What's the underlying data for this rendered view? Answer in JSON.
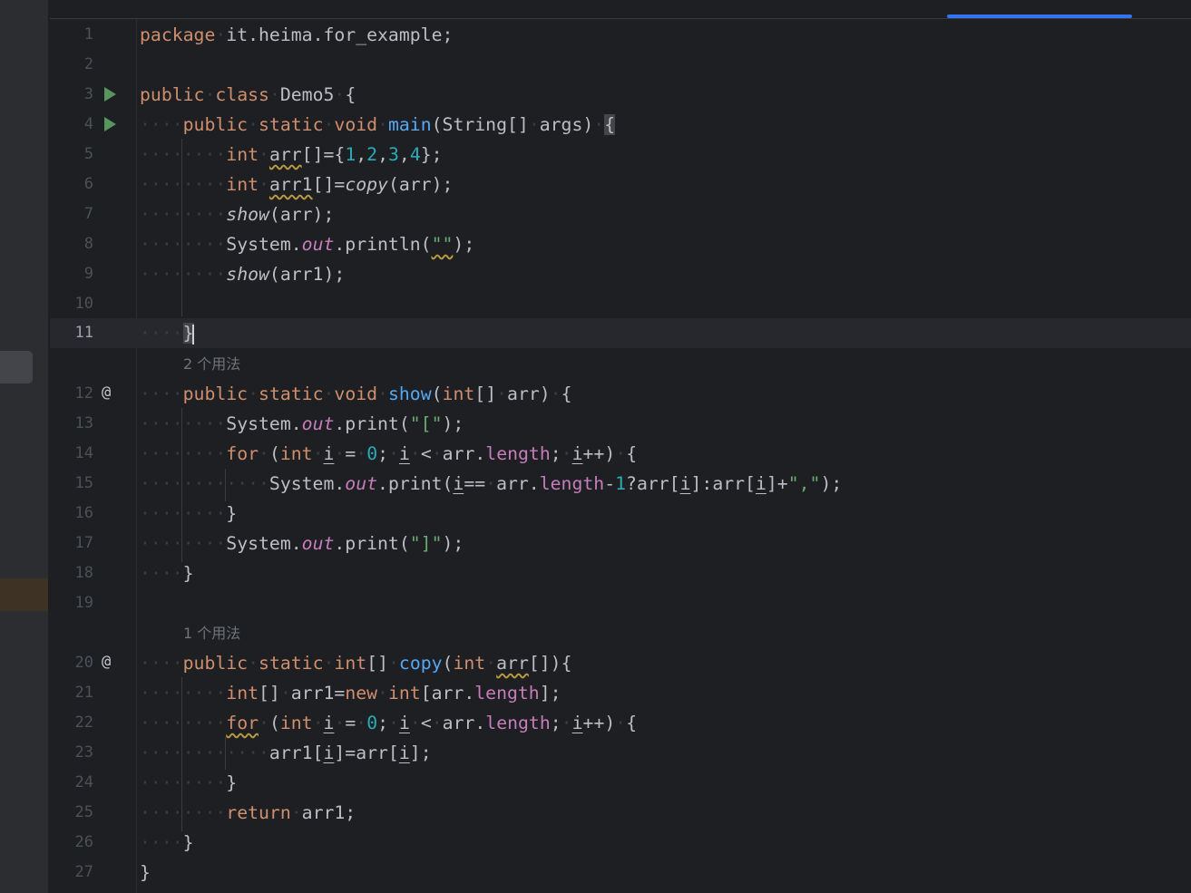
{
  "editor": {
    "lines": [
      {
        "n": "1"
      },
      {
        "n": "2"
      },
      {
        "n": "3"
      },
      {
        "n": "4"
      },
      {
        "n": "5"
      },
      {
        "n": "6"
      },
      {
        "n": "7"
      },
      {
        "n": "8"
      },
      {
        "n": "9"
      },
      {
        "n": "10"
      },
      {
        "n": "11"
      },
      {
        "n": "12"
      },
      {
        "n": "13"
      },
      {
        "n": "14"
      },
      {
        "n": "15"
      },
      {
        "n": "16"
      },
      {
        "n": "17"
      },
      {
        "n": "18"
      },
      {
        "n": "19"
      },
      {
        "n": "20"
      },
      {
        "n": "21"
      },
      {
        "n": "22"
      },
      {
        "n": "23"
      },
      {
        "n": "24"
      },
      {
        "n": "25"
      },
      {
        "n": "26"
      },
      {
        "n": "27"
      }
    ],
    "hints": {
      "show_usages": "2 个用法",
      "copy_usages": "1 个用法"
    },
    "tokens": {
      "package": "package",
      "package_name": "it.heima.for_example;",
      "public": "public",
      "class": "class",
      "static": "static",
      "void": "void",
      "int": "int",
      "for": "for",
      "new": "new",
      "return": "return",
      "class_name": "Demo5",
      "main": "main",
      "show": "show",
      "copy": "copy",
      "out": "out",
      "length": "length",
      "n1": "1",
      "n2": "2",
      "n3": "3",
      "n4": "4",
      "n0": "0",
      "s_empty": "\"\"",
      "s_open": "\"[\"",
      "s_close": "\"]\"",
      "s_comma": "\",\""
    },
    "current_line": "11"
  },
  "colors": {
    "background": "#1e1f22",
    "keyword": "#cf8e6d",
    "number": "#2aacb8",
    "string": "#6aab73",
    "function": "#56a8f5",
    "field": "#c77dbb",
    "run_icon": "#57965c",
    "tab_accent": "#3574f0"
  },
  "icons": {
    "run": "run-icon",
    "override": "implemented-at-icon"
  }
}
